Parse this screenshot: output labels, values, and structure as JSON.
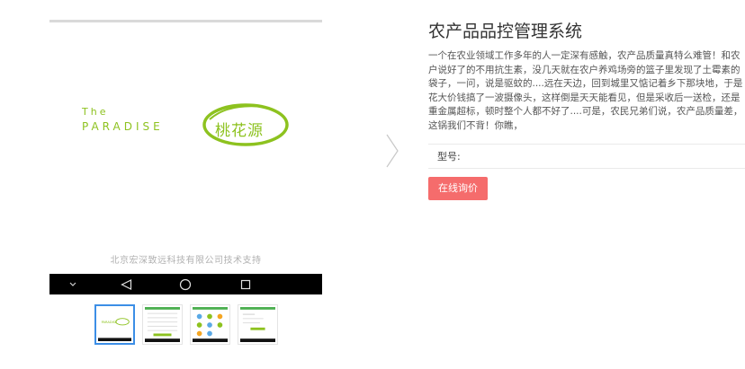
{
  "gallery": {
    "splash": {
      "brand_the": "The",
      "brand_name": "PARADISE",
      "brand_cn": "桃花源",
      "footer": "北京宏深致远科技有限公司技术支持"
    },
    "navbar_keys": [
      "chevron-down-icon",
      "back-triangle-icon",
      "home-circle-icon",
      "recent-square-icon"
    ],
    "thumbnails": [
      {
        "name": "thumbnail-1",
        "active": true
      },
      {
        "name": "thumbnail-2",
        "active": false
      },
      {
        "name": "thumbnail-3",
        "active": false
      },
      {
        "name": "thumbnail-4",
        "active": false
      }
    ],
    "next_icon": "chevron-right-icon"
  },
  "product": {
    "title": "农产品品控管理系统",
    "description": "一个在农业领域工作多年的人一定深有感触，农产品质量真特么难管！和农户说好了的不用抗生素，没几天就在农户养鸡场旁的篮子里发现了土霉素的袋子，一问，说是驱蚊的....远在天边，回到城里又惦记着乡下那块地，于是花大价钱搞了一波摄像头，这样倒是天天能看见，但是采收后一送检，还是重金属超标，顿时整个人都不好了....可是，农民兄弟们说，农产品质量差，这锅我们不背！你瞧，",
    "spec_label": "型号:",
    "inquiry_button": "在线询价"
  },
  "colors": {
    "brand_green": "#8dc21f",
    "button_red": "#f56c6c",
    "thumb_active_border": "#3c8ee6"
  }
}
